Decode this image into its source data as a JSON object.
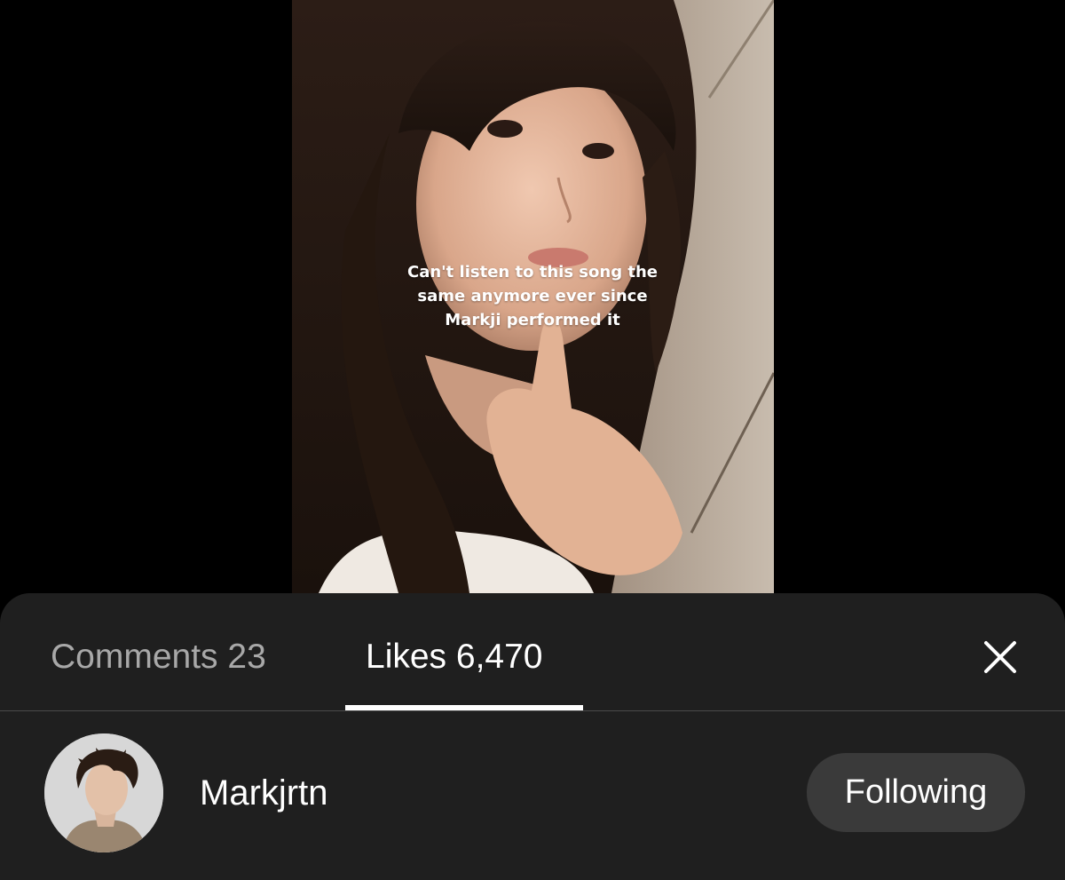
{
  "video": {
    "caption": "Can't listen to this song the\nsame anymore ever since\nMarkji performed it"
  },
  "sheet": {
    "tabs": [
      {
        "label": "Comments 23",
        "active": false
      },
      {
        "label": "Likes 6,470",
        "active": true
      }
    ],
    "close_icon": "close-icon"
  },
  "likes_list": [
    {
      "username": "Markjrtn",
      "follow_label": "Following"
    }
  ],
  "colors": {
    "sheet_background": "#1f1f1f",
    "active_tab": "#ffffff",
    "inactive_tab": "#a8a8a8",
    "follow_button": "#3a3a3a"
  }
}
